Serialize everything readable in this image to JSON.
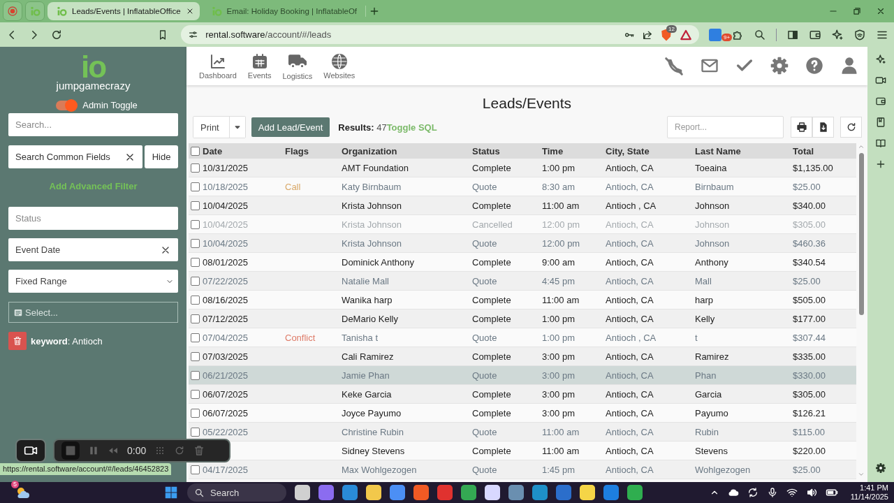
{
  "browser": {
    "tabs": [
      {
        "title": "Leads/Events | InflatableOffice",
        "selected": true
      },
      {
        "title": "Email: Holiday Booking | InflatableOf",
        "selected": false
      }
    ],
    "url_host": "rental.software",
    "url_path": "/account/#/leads",
    "shield_badge": "12",
    "extension_badge": "9+"
  },
  "app": {
    "account": {
      "logo": "io",
      "name": "jumpgamecrazy"
    },
    "admin_toggle": {
      "label": "Admin Toggle",
      "on": true
    },
    "sidebar": {
      "search_placeholder": "Search...",
      "common_fields_placeholder": "Search Common Fields",
      "hide_button": "Hide",
      "advanced_filter_link": "Add Advanced Filter",
      "status_placeholder": "Status",
      "date_field_value": "Event Date",
      "range_select_value": "Fixed Range",
      "date_picker_placeholder": "Select...",
      "filter_chip": "**keyword**: Antioch"
    },
    "nav": [
      {
        "label": "Dashboard",
        "kind": "chart"
      },
      {
        "label": "Events",
        "kind": "calendar"
      },
      {
        "label": "Logistics",
        "kind": "truck"
      },
      {
        "label": "Websites",
        "kind": "globe"
      }
    ],
    "title": "Leads/Events",
    "toolbar": {
      "print_button": "Print",
      "add_button": "Add Lead/Event",
      "results": "**Results:** 47",
      "toggle_sql_link": "Toggle SQL",
      "report_placeholder": "Report..."
    },
    "table": {
      "columns": [
        "Date",
        "Flags",
        "Organization",
        "Status",
        "Time",
        "City, State",
        "Last Name",
        "Total"
      ],
      "select_all_checked": false,
      "rows": [
        {
          "date": "10/31/2025",
          "organization": "AMT Foundation",
          "status": "Complete",
          "time": "1:00 pm",
          "city_state": "Antioch, CA",
          "last_name": "Toeaina",
          "total": "$1,135.00",
          "kind": "normal",
          "checked": false,
          "highlighted": false
        },
        {
          "date": "10/18/2025",
          "flag": {
            "label": "Call",
            "color": "#d9a868"
          },
          "organization": "Katy Birnbaum",
          "status": "Quote",
          "time": "8:30 am",
          "city_state": "Antioch, CA",
          "last_name": "Birnbaum",
          "total": "$25.00",
          "kind": "muted",
          "checked": false,
          "highlighted": false
        },
        {
          "date": "10/04/2025",
          "organization": "Krista Johnson",
          "status": "Complete",
          "time": "11:00 am",
          "city_state": "Antioch , CA",
          "last_name": "Johnson",
          "total": "$340.00",
          "kind": "normal",
          "checked": false,
          "highlighted": false
        },
        {
          "date": "10/04/2025",
          "organization": "Krista Johnson",
          "status": "Cancelled",
          "time": "12:00 pm",
          "city_state": "Antioch, CA",
          "last_name": "Johnson",
          "total": "$305.00",
          "kind": "faint",
          "checked": false,
          "highlighted": false
        },
        {
          "date": "10/04/2025",
          "organization": "Krista Johnson",
          "status": "Quote",
          "time": "12:00 pm",
          "city_state": "Antioch, CA",
          "last_name": "Johnson",
          "total": "$460.36",
          "kind": "muted",
          "checked": false,
          "highlighted": false
        },
        {
          "date": "08/01/2025",
          "organization": "Dominick Anthony",
          "status": "Complete",
          "time": "9:00 am",
          "city_state": "Antioch, CA",
          "last_name": "Anthony",
          "total": "$340.54",
          "kind": "normal",
          "checked": false,
          "highlighted": false
        },
        {
          "date": "07/22/2025",
          "organization": "Natalie Mall",
          "status": "Quote",
          "time": "4:45 pm",
          "city_state": "Antioch, CA",
          "last_name": "Mall",
          "total": "$25.00",
          "kind": "muted",
          "checked": false,
          "highlighted": false
        },
        {
          "date": "08/16/2025",
          "organization": "Wanika harp",
          "status": "Complete",
          "time": "11:00 am",
          "city_state": "Antioch, CA",
          "last_name": "harp",
          "total": "$505.00",
          "kind": "normal",
          "checked": false,
          "highlighted": false
        },
        {
          "date": "07/12/2025",
          "organization": "DeMario Kelly",
          "status": "Complete",
          "time": "1:00 pm",
          "city_state": "Antioch, CA",
          "last_name": "Kelly",
          "total": "$177.00",
          "kind": "normal",
          "checked": false,
          "highlighted": false
        },
        {
          "date": "07/04/2025",
          "flag": {
            "label": "Conflict",
            "color": "#de7b68"
          },
          "organization": "Tanisha t",
          "status": "Quote",
          "time": "1:00 pm",
          "city_state": "Antioch , CA",
          "last_name": "t",
          "total": "$307.44",
          "kind": "muted",
          "checked": false,
          "highlighted": false
        },
        {
          "date": "07/03/2025",
          "organization": "Cali Ramirez",
          "status": "Complete",
          "time": "3:00 pm",
          "city_state": "Antioch, CA",
          "last_name": "Ramirez",
          "total": "$335.00",
          "kind": "normal",
          "checked": false,
          "highlighted": false
        },
        {
          "date": "06/21/2025",
          "organization": "Jamie Phan",
          "status": "Quote",
          "time": "3:00 pm",
          "city_state": "Antioch, CA",
          "last_name": "Phan",
          "total": "$330.00",
          "kind": "muted",
          "checked": false,
          "highlighted": true
        },
        {
          "date": "06/07/2025",
          "organization": "Keke Garcia",
          "status": "Complete",
          "time": "3:00 pm",
          "city_state": "Antioch, CA",
          "last_name": "Garcia",
          "total": "$305.00",
          "kind": "normal",
          "checked": false,
          "highlighted": false
        },
        {
          "date": "06/07/2025",
          "organization": "Joyce Payumo",
          "status": "Complete",
          "time": "3:00 pm",
          "city_state": "Antioch, CA",
          "last_name": "Payumo",
          "total": "$126.21",
          "kind": "normal",
          "checked": false,
          "highlighted": false
        },
        {
          "date": "05/22/2025",
          "organization": "Christine Rubin",
          "status": "Quote",
          "time": "11:00 am",
          "city_state": "Antioch, CA",
          "last_name": "Rubin",
          "total": "$115.00",
          "kind": "muted",
          "checked": false,
          "highlighted": false
        },
        {
          "organization": "Sidney Stevens",
          "status": "Complete",
          "time": "11:00 am",
          "city_state": "Antioch, CA",
          "last_name": "Stevens",
          "total": "$220.00",
          "kind": "normal",
          "highlighted": false
        },
        {
          "date": "04/17/2025",
          "organization": "Max Wohlgezogen",
          "status": "Quote",
          "time": "1:45 pm",
          "city_state": "Antioch, CA",
          "last_name": "Wohlgezogen",
          "total": "$25.00",
          "kind": "muted",
          "checked": false,
          "highlighted": false
        }
      ]
    }
  },
  "recorder": {
    "time": "0:00"
  },
  "status_url": "https://rental.software/account/#/leads/46452823",
  "taskbar": {
    "weather_badge": "5",
    "search_placeholder": "Search",
    "time": "1:41 PM",
    "date": "11/14/2025"
  }
}
